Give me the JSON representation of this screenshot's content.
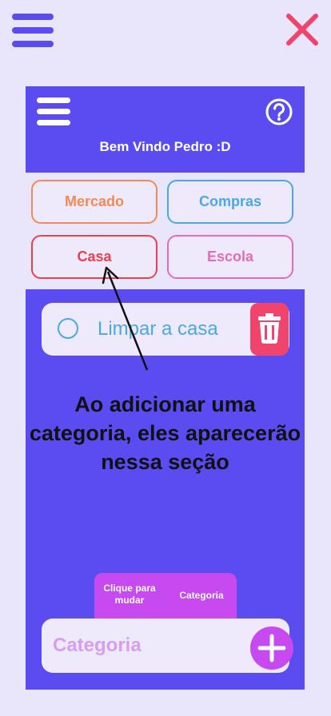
{
  "header": {
    "welcome": "Bem Vindo Pedro :D"
  },
  "categories": [
    {
      "label": "Mercado",
      "color": "#f28a55"
    },
    {
      "label": "Compras",
      "color": "#4aa7e8"
    },
    {
      "label": "Casa",
      "color": "#ee3f4d"
    },
    {
      "label": "Escola",
      "color": "#e56bb8"
    }
  ],
  "task": {
    "text": "Limpar a casa"
  },
  "annotation": "Ao adicionar uma categoria, eles aparecerão nessa seção",
  "toggle": {
    "option_a": "Clique para mudar",
    "option_b": "Categoria"
  },
  "input": {
    "placeholder": "Categoria"
  },
  "colors": {
    "primary": "#5a4cf0",
    "accent": "#c64af0",
    "danger": "#f0446c",
    "background": "#e9e6fb"
  },
  "icons": [
    "hamburger-menu-icon",
    "close-icon",
    "help-icon",
    "radio-circle-icon",
    "trash-icon",
    "plus-icon",
    "arrow-icon"
  ]
}
